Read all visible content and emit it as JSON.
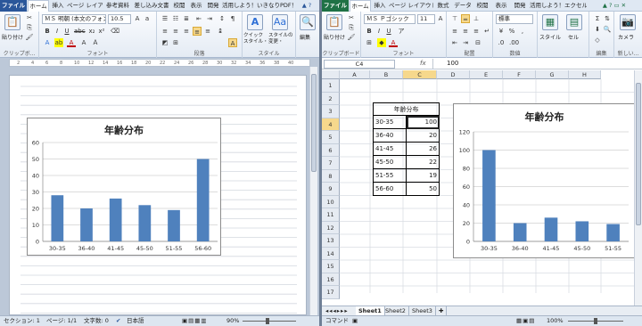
{
  "word": {
    "tabs": [
      "ファイル",
      "ホーム",
      "挿入",
      "ページ レイアウ",
      "参考資料",
      "差し込み文書",
      "校閲",
      "表示",
      "開発",
      "活用しよう！",
      "いきなりPDF！"
    ],
    "ribbon": {
      "paste_label": "貼り付け",
      "clipboard_group": "クリップボ...",
      "font_name": "ＭＳ 明朝 (本文のフォン",
      "font_size": "10.5",
      "font_group": "フォント",
      "paragraph_group": "段落",
      "quick_style_label": "クイック\nスタイル・",
      "change_style_label": "スタイルの\n変更・",
      "style_group": "スタイル",
      "edit_label": "編集"
    },
    "ruler_ticks": [
      "2",
      "4",
      "6",
      "8",
      "10",
      "12",
      "14",
      "16",
      "18",
      "20",
      "22",
      "24",
      "26",
      "28",
      "30",
      "32",
      "34",
      "36",
      "38",
      "40"
    ],
    "status": {
      "section": "セクション: 1",
      "page": "ページ: 1/1",
      "words": "文字数: 0",
      "language": "日本語",
      "zoom": "90%"
    }
  },
  "excel": {
    "tabs": [
      "ファイル",
      "ホーム",
      "挿入",
      "ページ レイアウト",
      "数式",
      "データ",
      "校閲",
      "表示",
      "開発",
      "活用しよう！エクセル"
    ],
    "ribbon": {
      "paste_label": "貼り付け",
      "clipboard_group": "クリップボード",
      "font_name": "ＭＳ Ｐゴシック",
      "font_size": "11",
      "font_group": "フォント",
      "number_format": "標準",
      "align_group": "配置",
      "number_group": "数値",
      "style_label": "スタイル",
      "cell_label": "セル",
      "edit_group": "編集",
      "camera_label": "カメラ",
      "new_group": "新しい..."
    },
    "name_box": "C4",
    "fx_label": "fx",
    "formula_value": "100",
    "columns": [
      "A",
      "B",
      "C",
      "D",
      "E",
      "F",
      "G",
      "H"
    ],
    "rows": [
      "1",
      "2",
      "3",
      "4",
      "5",
      "6",
      "7",
      "8",
      "9",
      "10",
      "11",
      "12",
      "13",
      "14",
      "15",
      "16",
      "17"
    ],
    "table": {
      "header": "年齢分布",
      "rows": [
        {
          "range": "30-35",
          "value": "100"
        },
        {
          "range": "36-40",
          "value": "20"
        },
        {
          "range": "41-45",
          "value": "26"
        },
        {
          "range": "45-50",
          "value": "22"
        },
        {
          "range": "51-55",
          "value": "19"
        },
        {
          "range": "56-60",
          "value": "50"
        }
      ]
    },
    "sheet_tabs": [
      "Sheet1",
      "Sheet2",
      "Sheet3"
    ],
    "status": {
      "mode": "コマンド",
      "zoom": "100%"
    }
  },
  "chart_data": [
    {
      "type": "bar",
      "title": "年齢分布",
      "categories": [
        "30-35",
        "36-40",
        "41-45",
        "45-50",
        "51-55",
        "56-60"
      ],
      "values": [
        28,
        20,
        26,
        22,
        19,
        50
      ],
      "ylim": [
        0,
        60
      ],
      "yticks": [
        0,
        10,
        20,
        30,
        40,
        50,
        60
      ],
      "grid": true,
      "color": "#4f81bd"
    },
    {
      "type": "bar",
      "title": "年齢分布",
      "categories": [
        "30-35",
        "36-40",
        "41-45",
        "45-50",
        "51-55"
      ],
      "values": [
        100,
        20,
        26,
        22,
        19
      ],
      "ylim": [
        0,
        120
      ],
      "yticks": [
        0,
        20,
        40,
        60,
        80,
        100,
        120
      ],
      "grid": true,
      "color": "#4f81bd"
    }
  ]
}
